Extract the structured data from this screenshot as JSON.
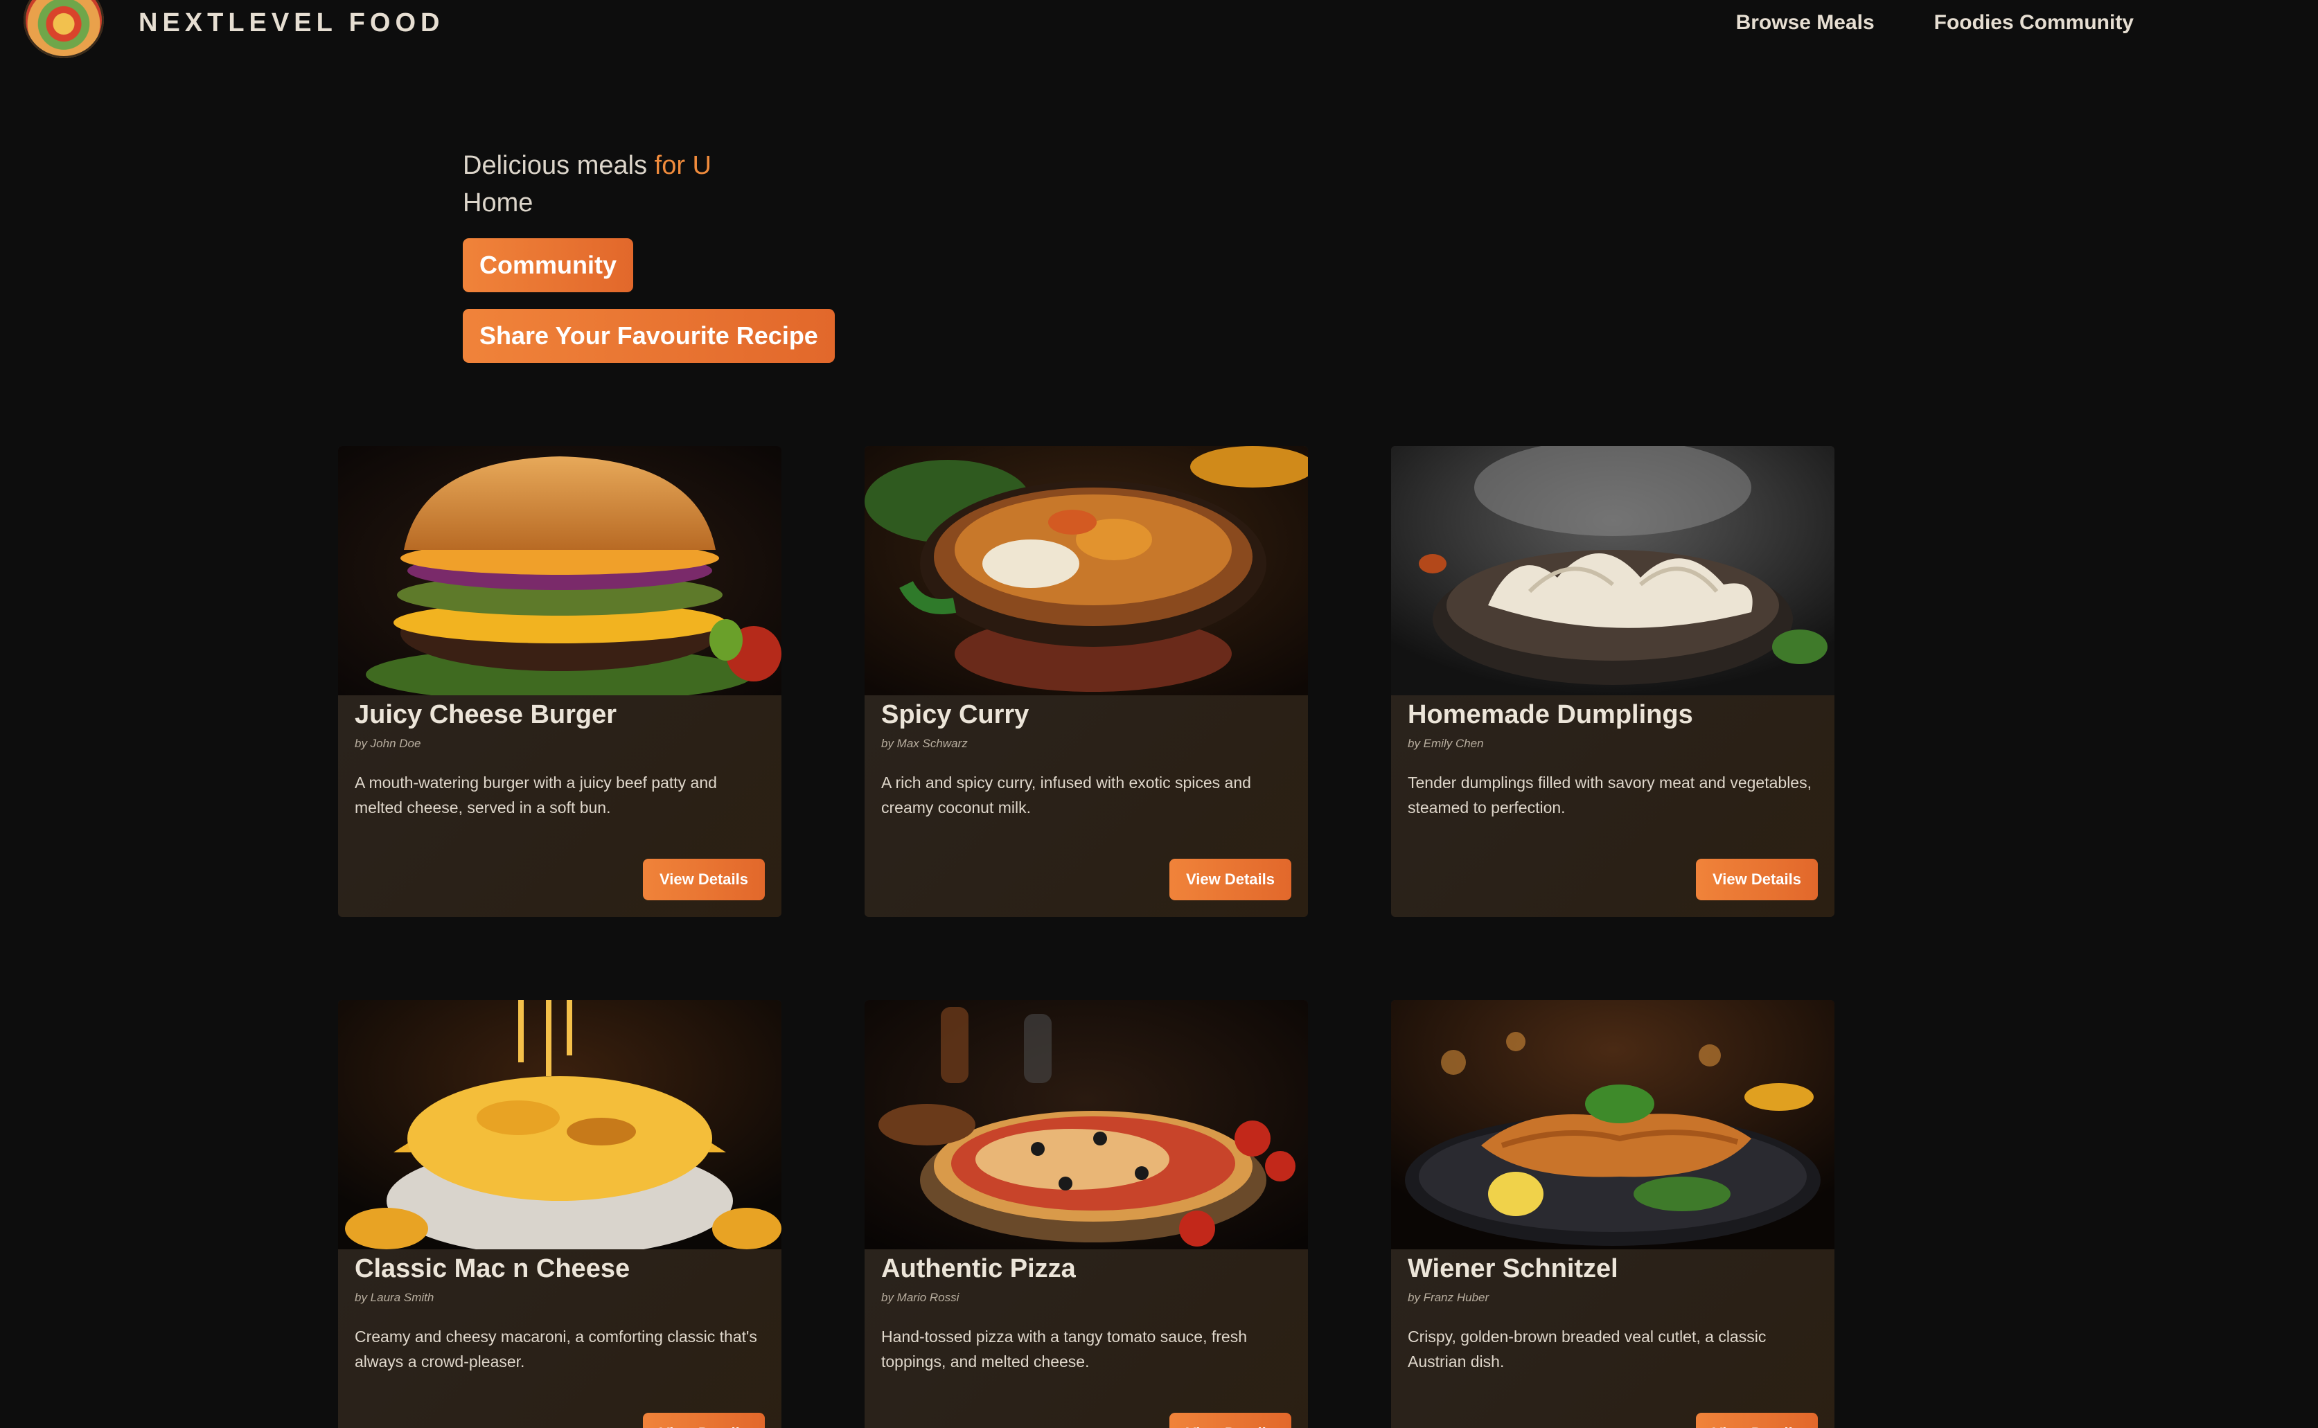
{
  "header": {
    "brand": "NEXTLEVEL FOOD",
    "nav": [
      "Browse Meals",
      "Foodies Community"
    ]
  },
  "hero": {
    "title_prefix": "Delicious meals",
    "title_accent": "for U",
    "subtitle": "Home",
    "community_button": "Community",
    "share_button": "Share Your Favourite Recipe"
  },
  "meals": [
    {
      "title": "Juicy Cheese Burger",
      "author": "by John Doe",
      "summary": "A mouth-watering burger with a juicy beef patty and melted cheese, served in a soft bun.",
      "button": "View Details",
      "image": "burger"
    },
    {
      "title": "Spicy Curry",
      "author": "by Max Schwarz",
      "summary": "A rich and spicy curry, infused with exotic spices and creamy coconut milk.",
      "button": "View Details",
      "image": "curry"
    },
    {
      "title": "Homemade Dumplings",
      "author": "by Emily Chen",
      "summary": "Tender dumplings filled with savory meat and vegetables, steamed to perfection.",
      "button": "View Details",
      "image": "dumplings"
    },
    {
      "title": "Classic Mac n Cheese",
      "author": "by Laura Smith",
      "summary": "Creamy and cheesy macaroni, a comforting classic that's always a crowd-pleaser.",
      "button": "View Details",
      "image": "mac-n-cheese"
    },
    {
      "title": "Authentic Pizza",
      "author": "by Mario Rossi",
      "summary": "Hand-tossed pizza with a tangy tomato sauce, fresh toppings, and melted cheese.",
      "button": "View Details",
      "image": "pizza"
    },
    {
      "title": "Wiener Schnitzel",
      "author": "by Franz Huber",
      "summary": "Crispy, golden-brown breaded veal cutlet, a classic Austrian dish.",
      "button": "View Details",
      "image": "schnitzel"
    }
  ],
  "colors": {
    "accent": "#f08b3c",
    "button_start": "#f0833a",
    "button_end": "#e2682b",
    "background": "#0d0d0d",
    "card": "#2a2219"
  }
}
